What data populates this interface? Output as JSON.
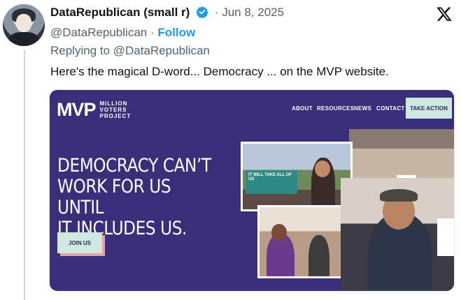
{
  "tweet": {
    "display_name": "DataRepublican (small r)",
    "date": "Jun 8, 2025",
    "separator": "·",
    "handle": "@DataRepublican",
    "follow_label": "Follow",
    "replying_to": "Replying to @DataRepublican",
    "text": "Here's the magical D-word... Democracy ... on the MVP website."
  },
  "icons": {
    "verified": "verified-badge-icon",
    "brand": "x-logo-icon",
    "verified_color": "#1d9bf0"
  },
  "website": {
    "logo_mark": "MVP",
    "logo_sub": [
      "MILLION",
      "VOTERS",
      "PROJECT"
    ],
    "nav": [
      "ABOUT",
      "RESOURCES",
      "NEWS",
      "CONTACT"
    ],
    "cta_label": "TAKE ACTION",
    "headline_lines": [
      "DEMOCRACY CAN’T",
      "WORK FOR US UNTIL",
      "IT INCLUDES US."
    ],
    "join_label": "JOIN US",
    "banner_text": "IT WILL TAKE ALL OF US",
    "background_color": "#3a2d7a",
    "button_color": "#cfe8df"
  }
}
